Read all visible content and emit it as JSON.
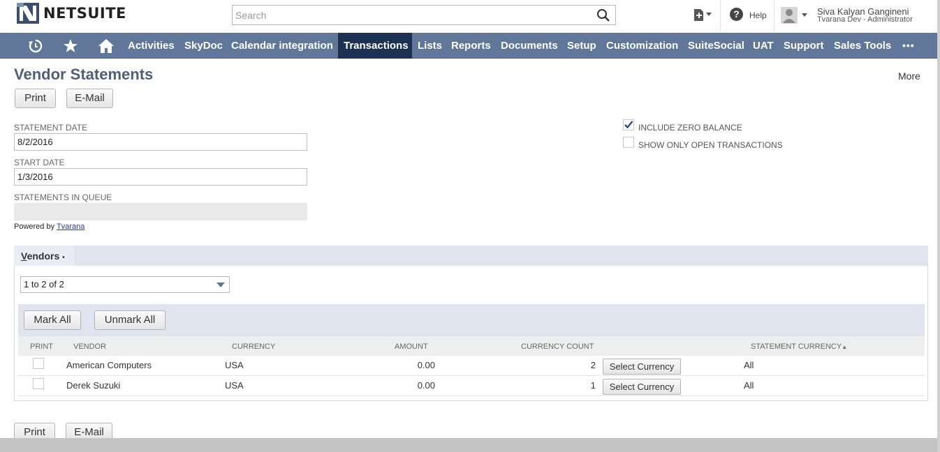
{
  "header": {
    "logo_text": "NETSUITE",
    "search_placeholder": "Search",
    "help_label": "Help",
    "user_name": "Siva Kalyan Gangineni",
    "user_role": "Tvarana Dev - Administrator"
  },
  "nav": {
    "icons": [
      "recent-icon",
      "star-icon",
      "home-icon"
    ],
    "items": [
      {
        "label": "Activities"
      },
      {
        "label": "SkyDoc"
      },
      {
        "label": "Calendar integration"
      },
      {
        "label": "Transactions",
        "active": true
      },
      {
        "label": "Lists"
      },
      {
        "label": "Reports"
      },
      {
        "label": "Documents"
      },
      {
        "label": "Setup"
      },
      {
        "label": "Customization"
      },
      {
        "label": "SuiteSocial"
      },
      {
        "label": "UAT"
      },
      {
        "label": "Support"
      },
      {
        "label": "Sales Tools"
      }
    ],
    "more_label": "•••"
  },
  "page": {
    "title": "Vendor Statements",
    "more_label": "More",
    "print_label": "Print",
    "email_label": "E-Mail"
  },
  "form": {
    "statement_date_label": "STATEMENT DATE",
    "statement_date_value": "8/2/2016",
    "start_date_label": "START DATE",
    "start_date_value": "1/3/2016",
    "queue_label": "STATEMENTS IN QUEUE",
    "powered_prefix": "Powered by",
    "powered_link": "Tvarana",
    "include_zero_label": "INCLUDE ZERO BALANCE",
    "include_zero_checked": true,
    "open_only_label": "SHOW ONLY OPEN TRANSACTIONS",
    "open_only_checked": false
  },
  "vendors": {
    "tab_label_first": "V",
    "tab_label_rest": "endors",
    "tab_dot": "•",
    "pager_value": "1 to 2 of 2",
    "mark_all_label": "Mark All",
    "unmark_all_label": "Unmark All",
    "columns": {
      "print": "PRINT",
      "vendor": "VENDOR",
      "currency": "CURRENCY",
      "amount": "AMOUNT",
      "currency_count": "CURRENCY COUNT",
      "statement_currency": "STATEMENT CURRENCY",
      "sort_indicator": "▲"
    },
    "select_currency_label": "Select Currency",
    "rows": [
      {
        "vendor": "American Computers",
        "currency": "USA",
        "amount": "0.00",
        "count": "2",
        "statement_currency": "All"
      },
      {
        "vendor": "Derek Suzuki",
        "currency": "USA",
        "amount": "0.00",
        "count": "1",
        "statement_currency": "All"
      }
    ]
  },
  "colors": {
    "nav_bg": "#607799",
    "nav_active": "#1d3153",
    "title": "#4d5f79",
    "listbar": "#dfe4ee"
  }
}
